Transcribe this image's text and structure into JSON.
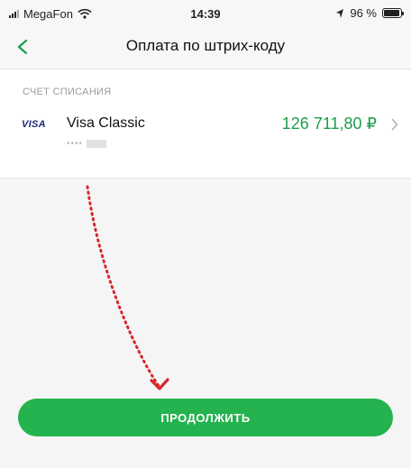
{
  "status_bar": {
    "carrier": "MegaFon",
    "time": "14:39",
    "battery_text": "96 %",
    "battery_level": 0.96,
    "icons": [
      "signal-icon",
      "wifi-icon",
      "location-icon",
      "battery-icon"
    ]
  },
  "nav": {
    "title": "Оплата по штрих-коду",
    "back_icon": "chevron-left-icon"
  },
  "account_section": {
    "label": "СЧЕТ СПИСАНИЯ",
    "card_logo": "VISA",
    "card_name": "Visa Classic",
    "card_number_mask": "••••",
    "balance": "126 711,80 ₽",
    "chevron_icon": "chevron-right-icon"
  },
  "actions": {
    "continue_label": "ПРОДОЛЖИТЬ"
  },
  "colors": {
    "accent_green": "#24b34e",
    "balance_green": "#1a9f4a",
    "annotation_red": "#d8262c",
    "back_icon_green": "#1a9f4a"
  }
}
